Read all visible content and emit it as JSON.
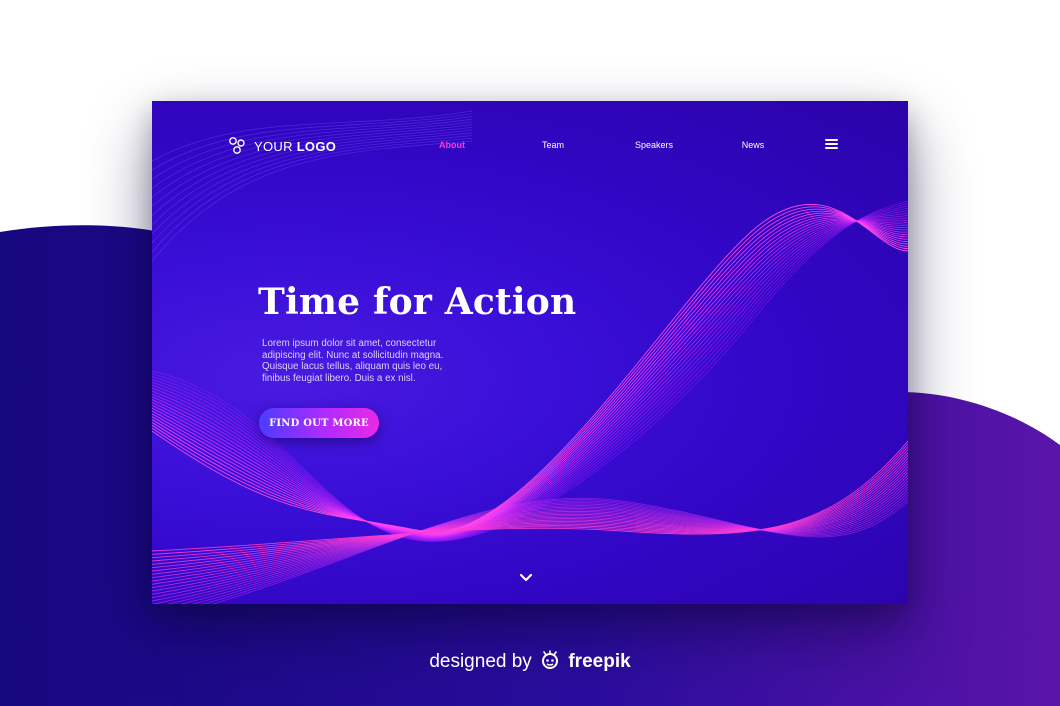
{
  "logo": {
    "text_light": "YOUR",
    "text_bold": "LOGO",
    "icon": "circles-logo-icon"
  },
  "nav": {
    "items": [
      {
        "label": "About",
        "active": true
      },
      {
        "label": "Team",
        "active": false
      },
      {
        "label": "Speakers",
        "active": false
      },
      {
        "label": "News",
        "active": false
      }
    ],
    "menu_icon": "hamburger-icon"
  },
  "hero": {
    "title": "Time for Action",
    "body": "Lorem ipsum dolor sit amet, consectetur adipiscing elit. Nunc at sollicitudin magna. Quisque lacus tellus, aliquam quis leo eu, finibus feugiat libero. Duis a ex nisl.",
    "cta_label": "FIND OUT MORE"
  },
  "scroll_icon": "chevron-down-icon",
  "credit": {
    "prefix": "designed by",
    "brand": "freepik",
    "icon": "freepik-mascot-icon"
  },
  "colors": {
    "accent": "#ff3ad6",
    "card_bg": "#3a0fd8",
    "wave": "#d23bff",
    "blob": "#1a0a8a",
    "page_bg": "#ffffff"
  }
}
